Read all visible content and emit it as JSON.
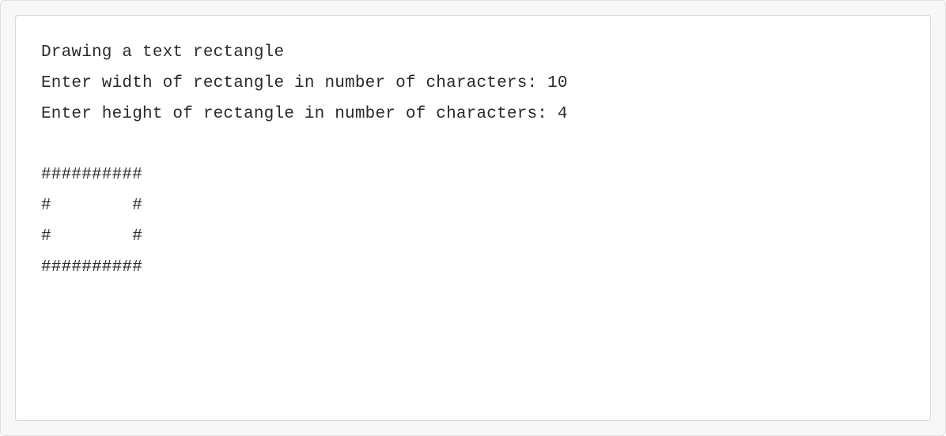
{
  "output": {
    "lines": [
      "Drawing a text rectangle",
      "Enter width of rectangle in number of characters: 10",
      "Enter height of rectangle in number of characters: 4",
      "",
      "##########",
      "#        #",
      "#        #",
      "##########"
    ]
  }
}
